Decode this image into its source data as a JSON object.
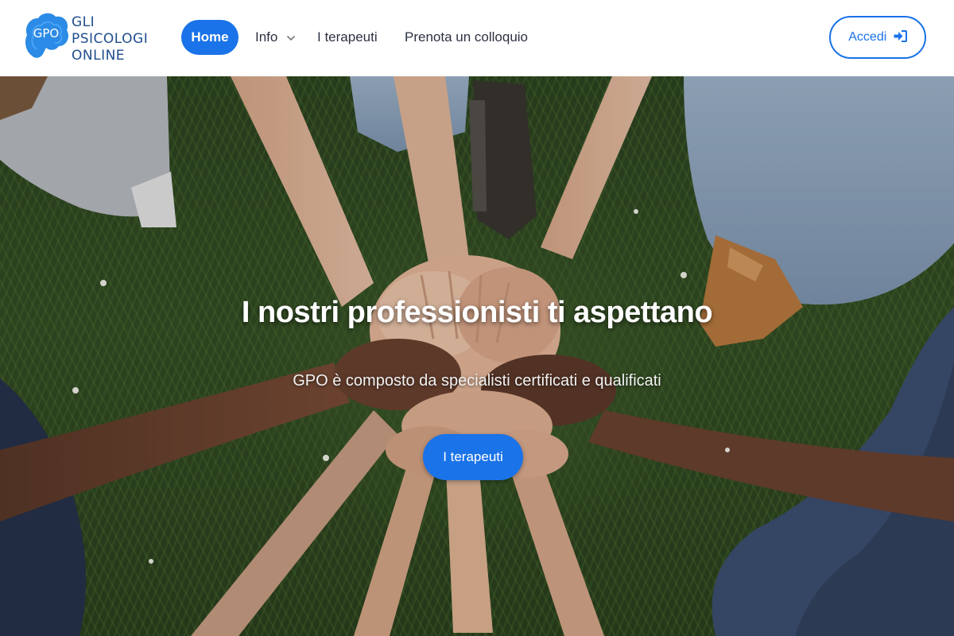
{
  "brand": {
    "logo_mark_text": "GPO",
    "name_lines": [
      "GLI",
      "PSICOLOGI",
      "ONLINE"
    ],
    "color": "#1e4d8c"
  },
  "nav": {
    "items": [
      {
        "label": "Home",
        "active": true
      },
      {
        "label": "Info",
        "has_dropdown": true,
        "icon": "chevron-down-icon"
      },
      {
        "label": "I terapeuti"
      },
      {
        "label": "Prenota un colloquio"
      }
    ],
    "login": {
      "label": "Accedi",
      "icon": "sign-in-icon"
    }
  },
  "hero": {
    "title": "I nostri professionisti ti aspettano",
    "subtitle": "GPO è composto da specialisti certificati e qualificati",
    "cta_label": "I terapeuti"
  },
  "colors": {
    "accent": "#1a73e8",
    "nav_text": "#2d3142",
    "grass": "#334d24"
  }
}
